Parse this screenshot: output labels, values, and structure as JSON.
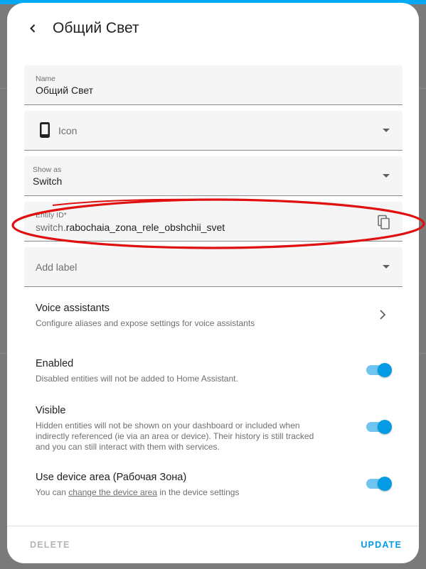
{
  "dialog": {
    "title": "Общий Свет"
  },
  "fields": {
    "name": {
      "label": "Name",
      "value": "Общий Свет"
    },
    "icon": {
      "placeholder": "Icon"
    },
    "show_as": {
      "label": "Show as",
      "value": "Switch"
    },
    "entity_id": {
      "label": "Entity ID*",
      "prefix": "switch.",
      "value": "rabochaia_zona_rele_obshchii_svet"
    },
    "add_label": {
      "placeholder": "Add label"
    }
  },
  "voice": {
    "title": "Voice assistants",
    "subtitle": "Configure aliases and expose settings for voice assistants"
  },
  "enabled": {
    "title": "Enabled",
    "subtitle": "Disabled entities will not be added to Home Assistant.",
    "on": true
  },
  "visible": {
    "title": "Visible",
    "subtitle_line1": "Hidden entities will not be shown on your dashboard or included when",
    "subtitle_line2": "indirectly referenced (ie via an area or device). Their history is still tracked",
    "subtitle_line3": "and you can still interact with them with services.",
    "on": true
  },
  "device_area": {
    "title": "Use device area (Рабочая Зона)",
    "subtitle_pre": "You can ",
    "subtitle_link": "change the device area",
    "subtitle_post": " in the device settings",
    "on": true
  },
  "footer": {
    "delete_label": "DELETE",
    "update_label": "UPDATE"
  },
  "colors": {
    "accent": "#039be5",
    "annotation": "#e01010"
  },
  "icons": {
    "back": "arrow-left-icon",
    "icon_field": "cellphone-icon",
    "copy": "content-copy-icon",
    "chevron": "chevron-right-icon"
  }
}
